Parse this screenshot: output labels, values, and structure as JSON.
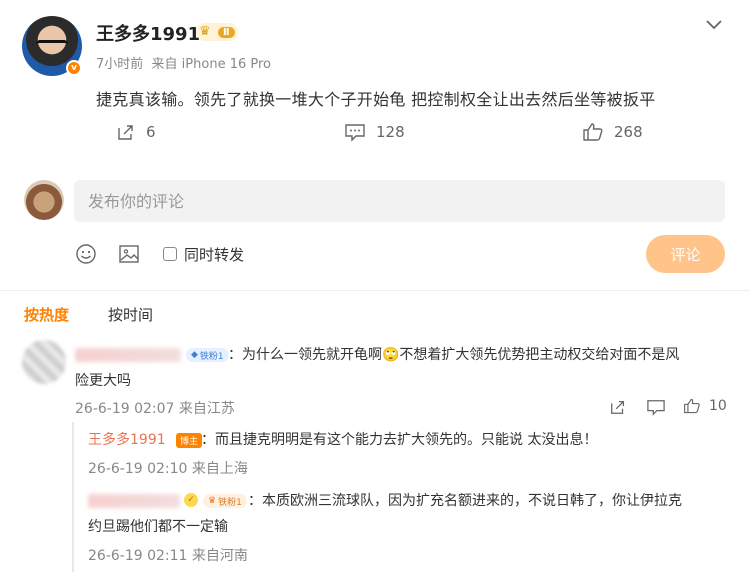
{
  "post": {
    "author": "王多多1991",
    "level_badge": "Ⅱ",
    "time": "7小时前",
    "source": "来自 iPhone 16 Pro",
    "text": "捷克真该输。领先了就换一堆大个子开始龟  把控制权全让出去然后坐等被扳平",
    "shares": "6",
    "comments": "128",
    "likes": "268"
  },
  "composer": {
    "placeholder": "发布你的评论",
    "repost_label": "同时转发",
    "submit_label": "评论"
  },
  "sort": {
    "hot": "按热度",
    "time": "按时间"
  },
  "comments": [
    {
      "fan_badge": "铁粉1",
      "text_line1": "：为什么一领先就开龟啊🙄不想着扩大领先优势把主动权交给对面不是风",
      "text_line2": "险更大吗",
      "time": "26-6-19 02:07",
      "location": "来自江苏",
      "likes": "10",
      "replies": [
        {
          "author": "王多多1991",
          "badge": "博主",
          "text": "：而且捷克明明是有这个能力去扩大领先的。只能说 太没出息！",
          "time": "26-6-19 02:10",
          "location": "来自上海"
        },
        {
          "fan_badge": "铁粉1",
          "text_line1": "：本质欧洲三流球队，因为扩充名额进来的，不说日韩了，你让伊拉克",
          "text_line2": "约旦踢他们都不一定输",
          "time": "26-6-19 02:11",
          "location": "来自河南"
        }
      ]
    }
  ],
  "colors": {
    "accent": "#ff8200",
    "owner": "#eb7350",
    "submit_bg": "#ffc48a",
    "fan_badge": "#3d7fd8"
  }
}
